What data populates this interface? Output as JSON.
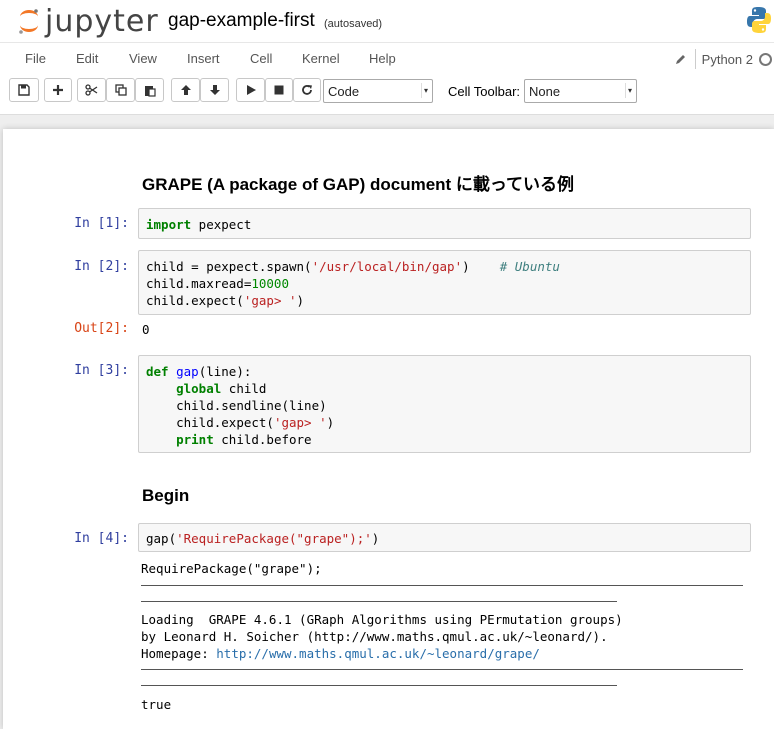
{
  "header": {
    "logo_text": "jupyter",
    "notebook_name": "gap-example-first",
    "autosave_status": "(autosaved)"
  },
  "menu": {
    "items": [
      "File",
      "Edit",
      "View",
      "Insert",
      "Cell",
      "Kernel",
      "Help"
    ],
    "kernel_name": "Python 2"
  },
  "toolbar": {
    "cell_type": "Code",
    "cell_toolbar_label": "Cell Toolbar:",
    "cell_toolbar_value": "None"
  },
  "cells": {
    "heading1": "GRAPE (A package of GAP) document に載っている例",
    "in1_prompt": "In [1]:",
    "in2_prompt": "In [2]:",
    "out2_prompt": "Out[2]:",
    "out2_value": "0",
    "in3_prompt": "In [3]:",
    "heading2": "Begin",
    "in4_prompt": "In [4]:",
    "out4_line1": "RequirePackage(\"grape\");",
    "out4_loading": "Loading  GRAPE 4.6.1 (GRaph Algorithms using PErmutation groups)",
    "out4_by": "by Leonard H. Soicher (http://www.maths.qmul.ac.uk/~leonard/).",
    "out4_homepage_label": "Homepage: ",
    "out4_homepage_url": "http://www.maths.qmul.ac.uk/~leonard/grape/",
    "out4_true": "true"
  },
  "code": {
    "c1_kw": "import",
    "c1_rest": " pexpect",
    "c2_a": "child = pexpect.spawn(",
    "c2_str": "'/usr/local/bin/gap'",
    "c2_b": ")    ",
    "c2_cm": "# Ubuntu",
    "c2_c": "child.maxread=",
    "c2_num": "10000",
    "c2_d": "child.expect(",
    "c2_str2": "'gap> '",
    "c2_e": ")",
    "c3_def": "def",
    "c3_fn": "gap",
    "c3_sig": "(line):",
    "c3_global": "global",
    "c3_child": " child",
    "c3_send": "child.sendline(line)",
    "c3_exp_a": "child.expect(",
    "c3_exp_str": "'gap> '",
    "c3_exp_b": ")",
    "c3_print": "print",
    "c3_print_rest": " child.before",
    "c4_a": "gap(",
    "c4_str": "'RequirePackage(\"grape\");'",
    "c4_b": ")"
  },
  "colors": {
    "prompt_in": "#303f9f",
    "prompt_out": "#d84315",
    "keyword": "#008000",
    "string": "#ba2121"
  }
}
